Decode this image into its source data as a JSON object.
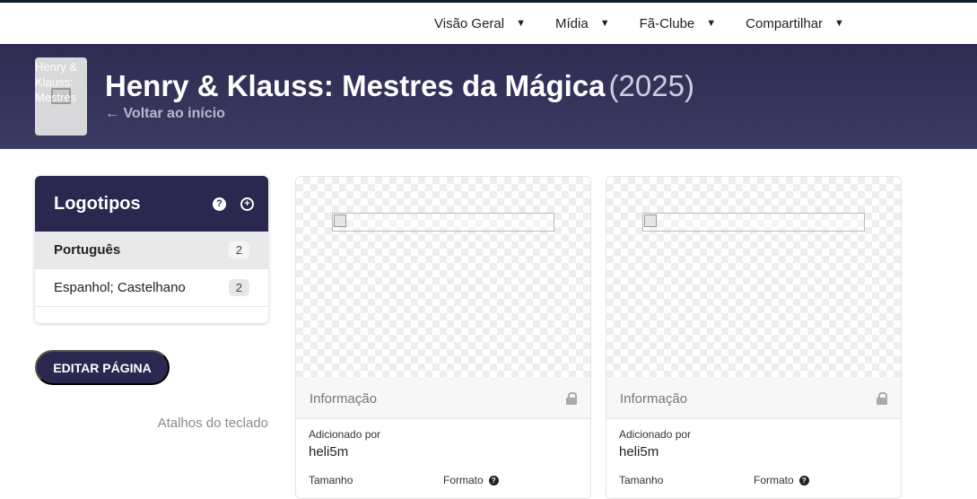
{
  "nav": {
    "items": [
      {
        "label": "Visão Geral"
      },
      {
        "label": "Mídia"
      },
      {
        "label": "Fã-Clube"
      },
      {
        "label": "Compartilhar"
      }
    ]
  },
  "hero": {
    "poster_alt": "Henry & Klauss: Mestres",
    "title": "Henry & Klauss: Mestres da Mágica",
    "year": "(2025)",
    "back_link": "← Voltar ao início"
  },
  "sidebar": {
    "card_title": "Logotipos",
    "languages": [
      {
        "name": "Português",
        "count": "2"
      },
      {
        "name": "Espanhol; Castelhano",
        "count": "2"
      }
    ],
    "edit_button": "EDITAR PÁGINA",
    "shortcuts": "Atalhos do teclado"
  },
  "cards": [
    {
      "info_label": "Informação",
      "added_by_label": "Adicionado por",
      "added_by": "heli5m",
      "size_label": "Tamanho",
      "format_label": "Formato"
    },
    {
      "info_label": "Informação",
      "added_by_label": "Adicionado por",
      "added_by": "heli5m",
      "size_label": "Tamanho",
      "format_label": "Formato"
    }
  ],
  "colors": {
    "header_bg": "#2f2c52",
    "accent": "#2b284f"
  }
}
